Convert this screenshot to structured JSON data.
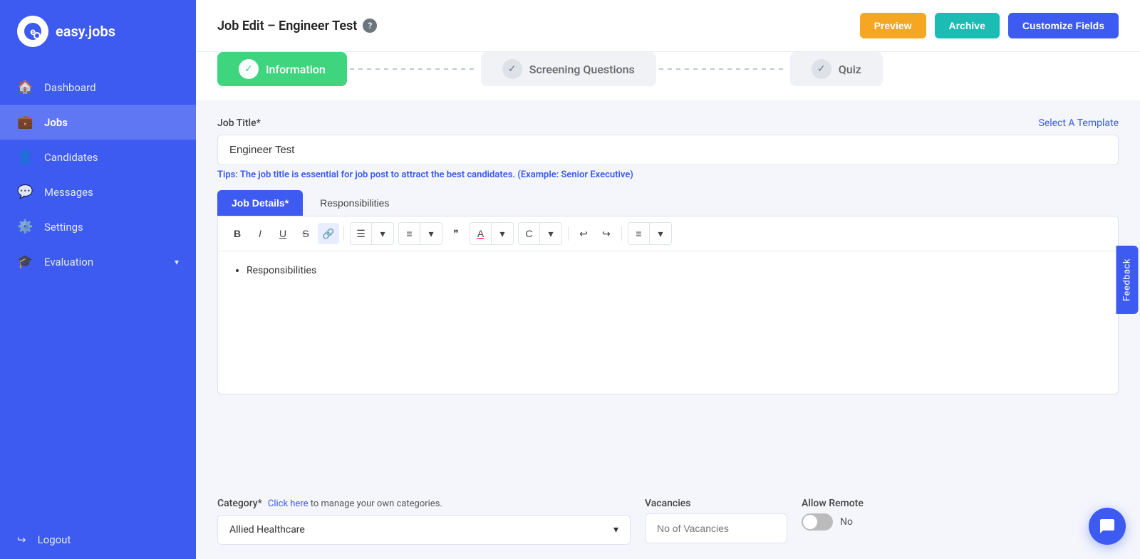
{
  "app": {
    "name": "easy.jobs",
    "logo_letter": "e"
  },
  "sidebar": {
    "items": [
      {
        "id": "dashboard",
        "label": "Dashboard",
        "icon": "🏠"
      },
      {
        "id": "jobs",
        "label": "Jobs",
        "icon": "💼",
        "active": true
      },
      {
        "id": "candidates",
        "label": "Candidates",
        "icon": "👤"
      },
      {
        "id": "messages",
        "label": "Messages",
        "icon": "💬"
      },
      {
        "id": "settings",
        "label": "Settings",
        "icon": "⚙️"
      },
      {
        "id": "evaluation",
        "label": "Evaluation",
        "icon": "🎓",
        "has_chevron": true
      }
    ],
    "logout": {
      "label": "Logout",
      "icon": "🚪"
    }
  },
  "header": {
    "title": "Job Edit – Engineer Test",
    "buttons": {
      "preview": "Preview",
      "archive": "Archive",
      "customize": "Customize Fields"
    }
  },
  "steps": [
    {
      "id": "information",
      "label": "Information",
      "active": true
    },
    {
      "id": "screening",
      "label": "Screening Questions",
      "active": false
    },
    {
      "id": "quiz",
      "label": "Quiz",
      "active": false
    }
  ],
  "form": {
    "job_title_label": "Job Title*",
    "job_title_value": "Engineer Test",
    "select_template": "Select A Template",
    "tips_prefix": "Tips:",
    "tips_text": " The job title is essential for job post to attract the best candidates. (Example: Senior Executive)",
    "tabs": [
      {
        "id": "job-details",
        "label": "Job Details*",
        "active": true
      },
      {
        "id": "responsibilities",
        "label": "Responsibilities",
        "active": false
      }
    ],
    "editor_content": "Responsibilities",
    "category_label": "Category*",
    "category_link": "Click here",
    "category_link_text": " to manage your own categories.",
    "category_value": "Allied Healthcare",
    "vacancies_label": "Vacancies",
    "vacancies_placeholder": "No of Vacancies",
    "allow_remote_label": "Allow Remote",
    "allow_remote_value": "No"
  },
  "toolbar": {
    "buttons": [
      "B",
      "I",
      "U",
      "S",
      "🔗"
    ],
    "list_btn": "≡",
    "ordered_btn": "≡",
    "quote_btn": "❝",
    "color_btn": "A",
    "bg_btn": "C",
    "undo_btn": "↩",
    "redo_btn": "↪",
    "align_btn": "≡"
  },
  "feedback_label": "Feedback",
  "chat_icon": "💬"
}
